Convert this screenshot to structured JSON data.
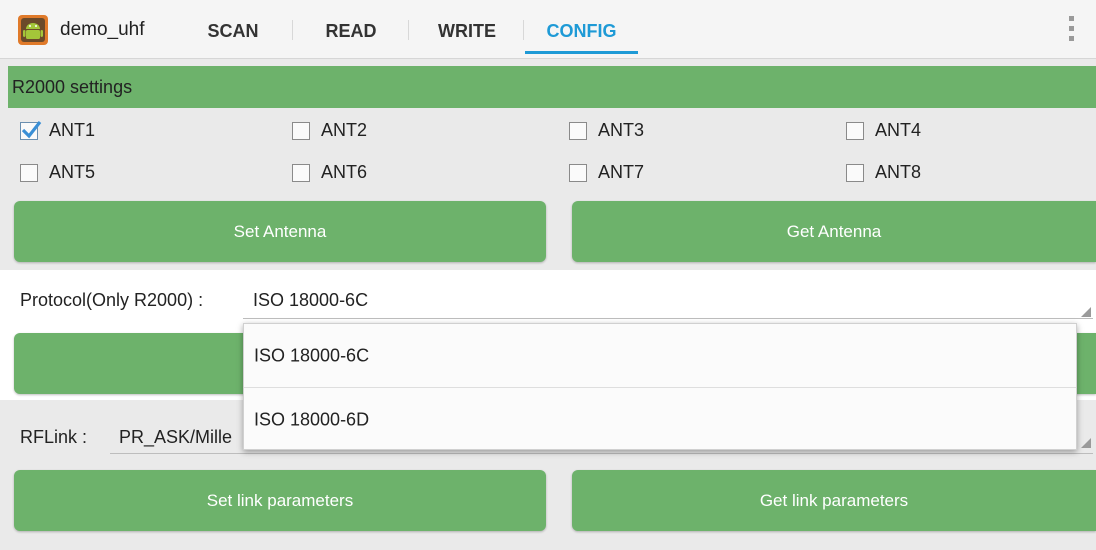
{
  "app": {
    "title": "demo_uhf",
    "icon": "android-icon"
  },
  "tabs": [
    {
      "label": "SCAN"
    },
    {
      "label": "READ"
    },
    {
      "label": "WRITE"
    },
    {
      "label": "CONFIG",
      "active": true
    }
  ],
  "menu": {
    "icon": "overflow-menu-icon"
  },
  "section": {
    "title": "R2000 settings"
  },
  "antennas": [
    {
      "label": "ANT1",
      "checked": true
    },
    {
      "label": "ANT2",
      "checked": false
    },
    {
      "label": "ANT3",
      "checked": false
    },
    {
      "label": "ANT4",
      "checked": false
    },
    {
      "label": "ANT5",
      "checked": false
    },
    {
      "label": "ANT6",
      "checked": false
    },
    {
      "label": "ANT7",
      "checked": false
    },
    {
      "label": "ANT8",
      "checked": false
    }
  ],
  "buttons": {
    "set_antenna": "Set Antenna",
    "get_antenna": "Get Antenna",
    "set_link": "Set link parameters",
    "get_link": "Get link parameters"
  },
  "protocol": {
    "label": "Protocol(Only R2000) :",
    "value": "ISO 18000-6C",
    "options": [
      "ISO 18000-6C",
      "ISO 18000-6D"
    ]
  },
  "rflink": {
    "label": "RFLink :",
    "value": "PR_ASK/Mille"
  },
  "colors": {
    "accent": "#1e9ad6",
    "green": "#6db26b"
  }
}
